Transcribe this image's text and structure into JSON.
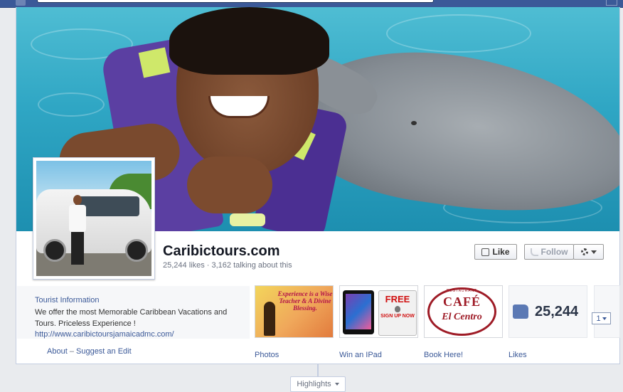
{
  "page": {
    "name": "Caribictours.com",
    "stats": "25,244 likes · 3,162 talking about this"
  },
  "actions": {
    "like_label": "Like",
    "follow_label": "Follow"
  },
  "about": {
    "category": "Tourist Information",
    "description": "We offer the most Memorable Caribbean Vacations and Tours. Priceless Experience !",
    "url": "http://www.caribictoursjamaicadmc.com/",
    "about_link": "About",
    "separator": "–",
    "suggest_edit_link": "Suggest an Edit"
  },
  "apps": [
    {
      "label": "Photos",
      "tile_text": "Experience is a Wise Teacher & A Divine Blessing."
    },
    {
      "label": "Win an IPad",
      "tile_text_free": "FREE",
      "tile_text_signup": "SIGN UP NOW"
    },
    {
      "label": "Book Here!",
      "tile_text_top": "RESTAURANT",
      "tile_text_cafe": "CAFÉ",
      "tile_text_sub": "El Centro"
    },
    {
      "label": "Likes",
      "count": "25,244"
    }
  ],
  "more_apps": {
    "count": "1"
  },
  "timeline": {
    "highlights_label": "Highlights"
  },
  "colors": {
    "brand": "#3b5998",
    "link": "#3b5998",
    "background": "#e9ebee"
  },
  "icons": [
    "facebook-logo-icon",
    "thumbs-up-icon",
    "rss-icon",
    "gear-icon",
    "chevron-down-icon"
  ]
}
